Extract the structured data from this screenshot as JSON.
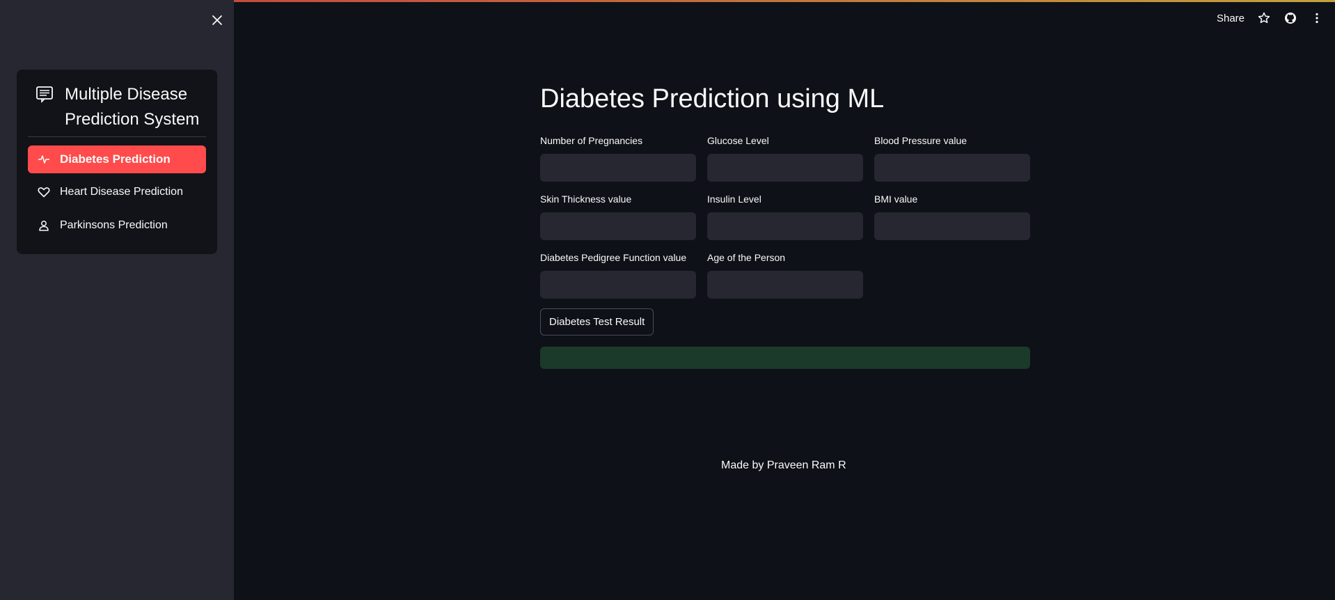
{
  "sidebar": {
    "close_icon": "close-icon",
    "menu_title": "Multiple Disease Prediction System",
    "menu_icon": "menu-card-icon",
    "items": [
      {
        "label": "Diabetes Prediction",
        "icon": "activity-icon",
        "active": true
      },
      {
        "label": "Heart Disease Prediction",
        "icon": "heart-icon",
        "active": false
      },
      {
        "label": "Parkinsons Prediction",
        "icon": "person-icon",
        "active": false
      }
    ]
  },
  "toolbar": {
    "share_label": "Share",
    "icons": [
      "star-icon",
      "github-icon",
      "more-vertical-icon"
    ]
  },
  "main": {
    "title": "Diabetes Prediction using ML",
    "fields": [
      {
        "label": "Number of Pregnancies",
        "value": ""
      },
      {
        "label": "Glucose Level",
        "value": ""
      },
      {
        "label": "Blood Pressure value",
        "value": ""
      },
      {
        "label": "Skin Thickness value",
        "value": ""
      },
      {
        "label": "Insulin Level",
        "value": ""
      },
      {
        "label": "BMI value",
        "value": ""
      },
      {
        "label": "Diabetes Pedigree Function value",
        "value": ""
      },
      {
        "label": "Age of the Person",
        "value": ""
      }
    ],
    "button_label": "Diabetes Test Result",
    "result_text": "",
    "footer": "Made by Praveen Ram R"
  },
  "colors": {
    "background": "#0e1117",
    "sidebar": "#262730",
    "accent": "#ff4b4b",
    "input_bg": "#262730",
    "success_bg": "#1b3a2a"
  }
}
